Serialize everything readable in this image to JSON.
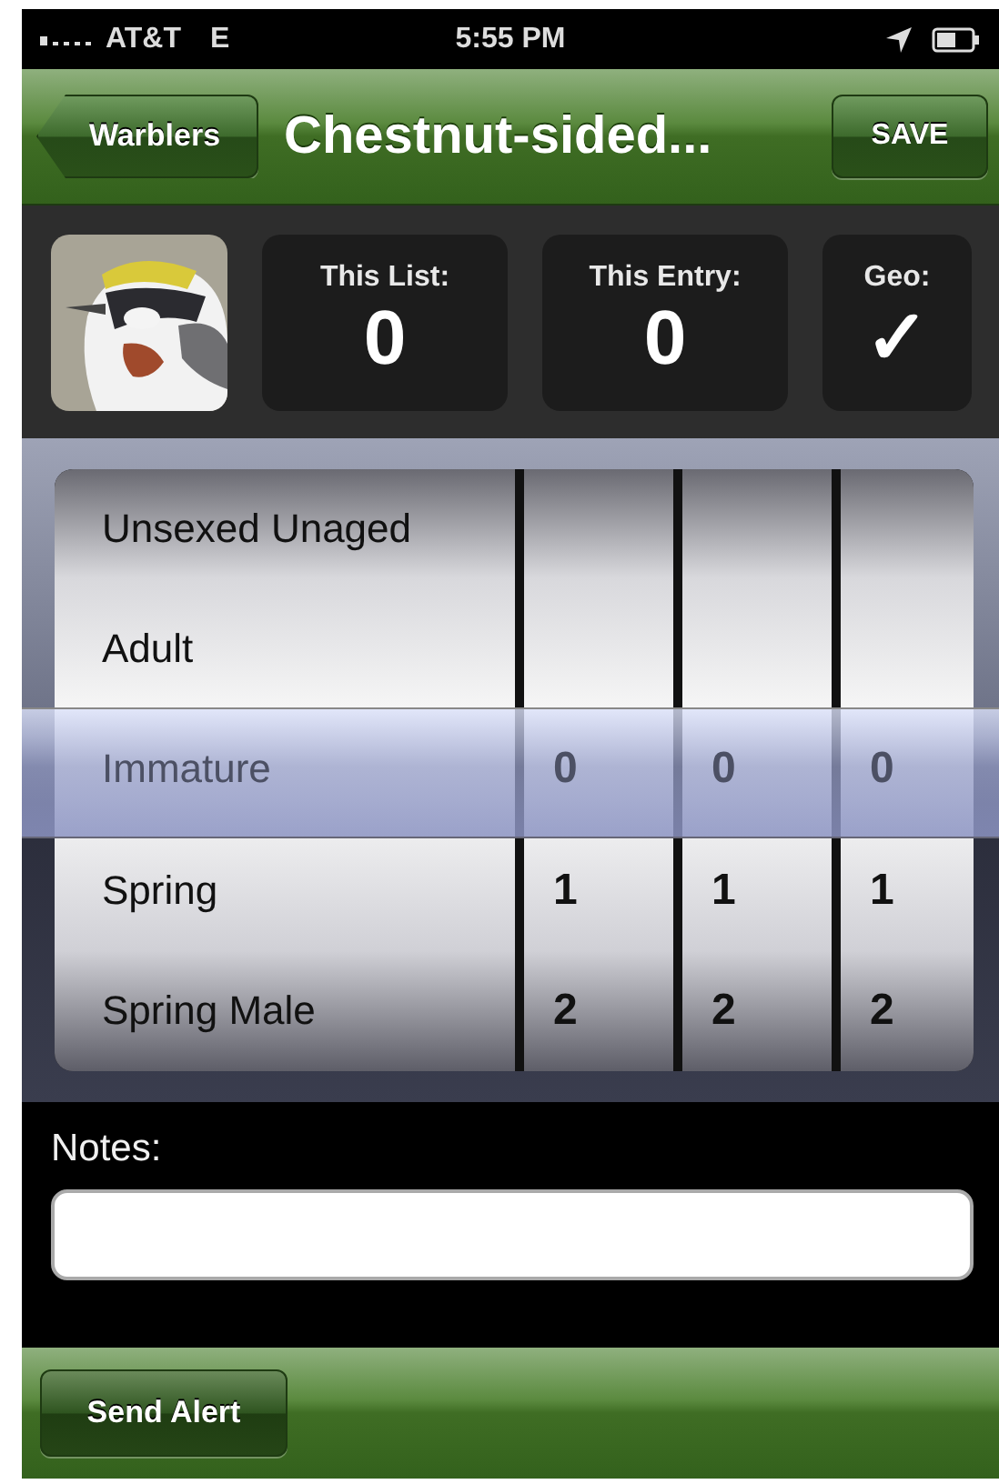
{
  "status_bar": {
    "carrier": "AT&T",
    "network": "E",
    "time": "5:55 PM"
  },
  "nav_bar": {
    "back_button": "Warblers",
    "title": "Chestnut-sided...",
    "action_button": "SAVE"
  },
  "stats": [
    {
      "label": "This List:",
      "value": "0"
    },
    {
      "label": "This Entry:",
      "value": "0"
    },
    {
      "label": "Geo:",
      "value": "✓"
    }
  ],
  "picker": {
    "wheels": [
      {
        "items": [
          {
            "label": "Unsexed Unaged",
            "selected": false
          },
          {
            "label": "Adult",
            "selected": false
          },
          {
            "label": "Immature",
            "selected": true
          },
          {
            "label": "Spring",
            "selected": false
          },
          {
            "label": "Spring Male",
            "selected": false
          }
        ]
      },
      {
        "items": [
          {
            "label": "0",
            "selected": true
          },
          {
            "label": "1",
            "selected": false
          },
          {
            "label": "2",
            "selected": false
          }
        ]
      },
      {
        "items": [
          {
            "label": "0",
            "selected": true
          },
          {
            "label": "1",
            "selected": false
          },
          {
            "label": "2",
            "selected": false
          }
        ]
      },
      {
        "items": [
          {
            "label": "0",
            "selected": true
          },
          {
            "label": "1",
            "selected": false
          },
          {
            "label": "2",
            "selected": false
          }
        ]
      }
    ]
  },
  "notes": {
    "label": "Notes:"
  },
  "toolbar": {
    "button": "Send Alert"
  }
}
